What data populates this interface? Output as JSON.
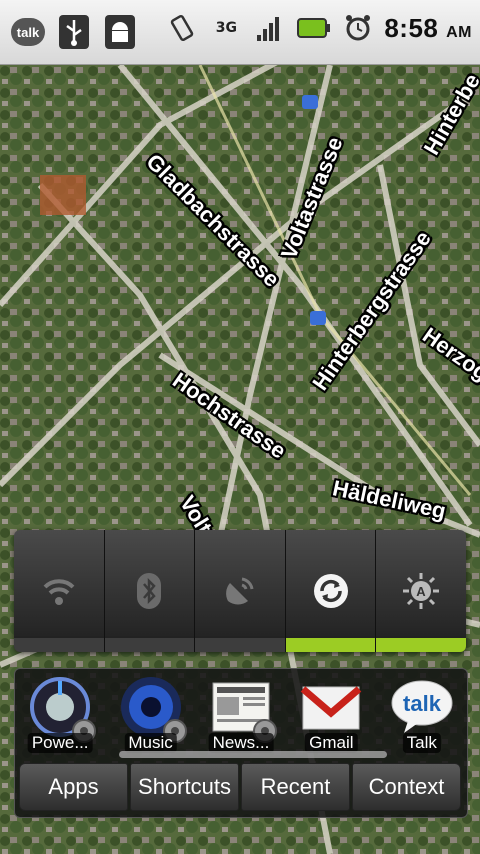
{
  "status_bar": {
    "left_icons": [
      "talk-icon",
      "usb-icon",
      "android-debug-icon"
    ],
    "talk_badge": "talk",
    "right_icons": [
      "vibrate-icon",
      "network-3g-icon",
      "signal-icon",
      "battery-icon",
      "alarm-icon"
    ],
    "network_label": "3G",
    "time": "8:58",
    "ampm": "AM"
  },
  "map": {
    "streets": [
      "Gladbachstrasse",
      "Voltastrasse",
      "Hinterbergstrasse",
      "Hochstrasse",
      "Voltas",
      "Häldeliweg",
      "Herzog",
      "Hinterbe"
    ]
  },
  "power_control": {
    "buttons": [
      {
        "name": "wifi-toggle",
        "icon": "wifi-icon",
        "on": false
      },
      {
        "name": "bluetooth-toggle",
        "icon": "bluetooth-icon",
        "on": false
      },
      {
        "name": "gps-toggle",
        "icon": "gps-icon",
        "on": false
      },
      {
        "name": "sync-toggle",
        "icon": "sync-icon",
        "on": true
      },
      {
        "name": "brightness-toggle",
        "icon": "brightness-auto-icon",
        "on": true
      }
    ],
    "accent": "#9ccc24"
  },
  "dock": {
    "apps": [
      {
        "label": "Powe...",
        "icon": "power-widget-icon"
      },
      {
        "label": "Music",
        "icon": "music-icon"
      },
      {
        "label": "News...",
        "icon": "news-icon"
      },
      {
        "label": "Gmail",
        "icon": "gmail-icon"
      },
      {
        "label": "Talk",
        "icon": "talk-icon"
      }
    ],
    "tabs": [
      "Apps",
      "Shortcuts",
      "Recent",
      "Context"
    ]
  }
}
